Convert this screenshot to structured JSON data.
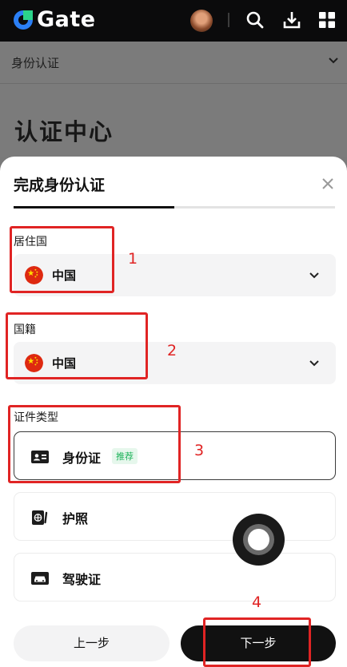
{
  "header": {
    "logo_text": "Gate",
    "icons": [
      "avatar",
      "search-icon",
      "download-icon",
      "grid-menu-icon"
    ]
  },
  "background_page": {
    "row_label": "身份认证",
    "title": "认证中心"
  },
  "sheet": {
    "title": "完成身份认证",
    "progress": 0.5,
    "residence": {
      "label": "居住国",
      "value": "中国"
    },
    "nationality": {
      "label": "国籍",
      "value": "中国"
    },
    "id_type": {
      "label": "证件类型",
      "options": [
        {
          "label": "身份证",
          "badge": "推荐",
          "selected": true,
          "icon": "id-card-icon"
        },
        {
          "label": "护照",
          "selected": false,
          "icon": "passport-icon"
        },
        {
          "label": "驾驶证",
          "selected": false,
          "icon": "driver-license-icon"
        }
      ]
    },
    "prev_button": "上一步",
    "next_button": "下一步"
  },
  "annotations": [
    "1",
    "2",
    "3",
    "4"
  ],
  "colors": {
    "annotation_red": "#e02424",
    "badge_green": "#1db35a",
    "logo_blue": "#1e7cf2",
    "logo_green": "#2bd48a"
  }
}
